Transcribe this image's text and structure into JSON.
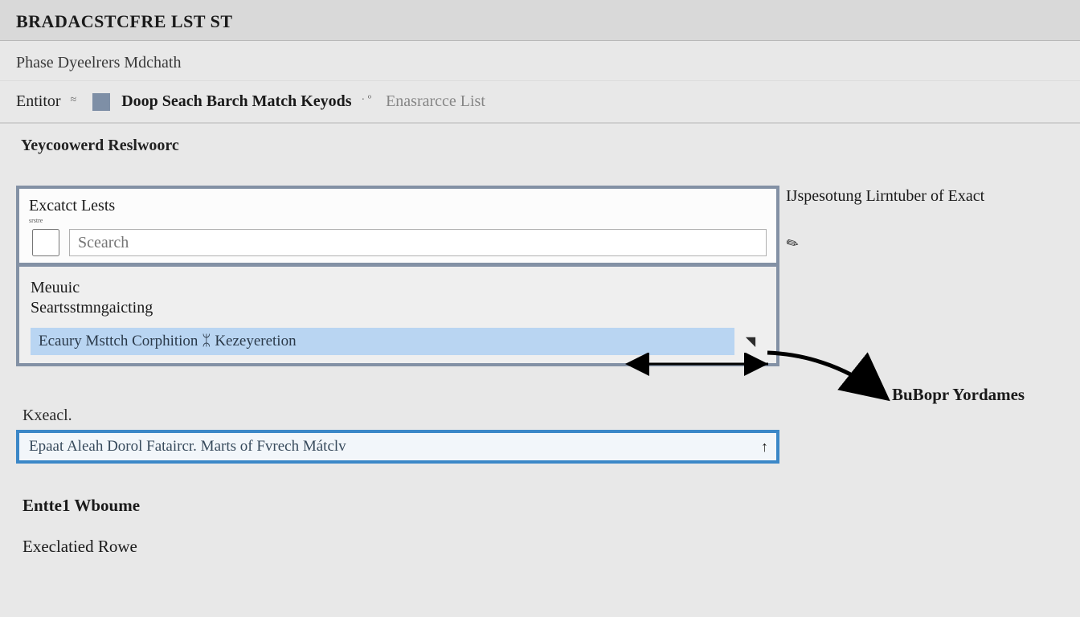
{
  "header": {
    "app_title": "BRADACSTCFRE LST ST",
    "subheading": "Phase Dyeelrers Mdchath"
  },
  "toolbar": {
    "prefix_label": "Entitor",
    "main_label": "Doop Seach Barch Match Keyods",
    "secondary_label": "Enasrarcce List"
  },
  "section_heading": "Yeycoowerd Reslwoorc",
  "panel1": {
    "title": "Excatct Lests",
    "tiny_sub": "srstre",
    "search_placeholder": "Scearch"
  },
  "panel2": {
    "title_line1": "Meuuic",
    "title_line2": "Seartsstmngaicting",
    "highlighted_text": "Ecaury Msttch Corphition ᛯ Kezeyeretion"
  },
  "side_note": "IJspesotung Lirntuber of Exact",
  "side_label_2": "BuBopr Yordames",
  "panel3": {
    "label": "Kxeacl.",
    "text": "Epaat Aleah Dorol Fataircr. Marts of Fvrech Mátclv"
  },
  "footer": {
    "line1": "Entte1 Wboume",
    "line2": "Execlatied Rowe"
  }
}
